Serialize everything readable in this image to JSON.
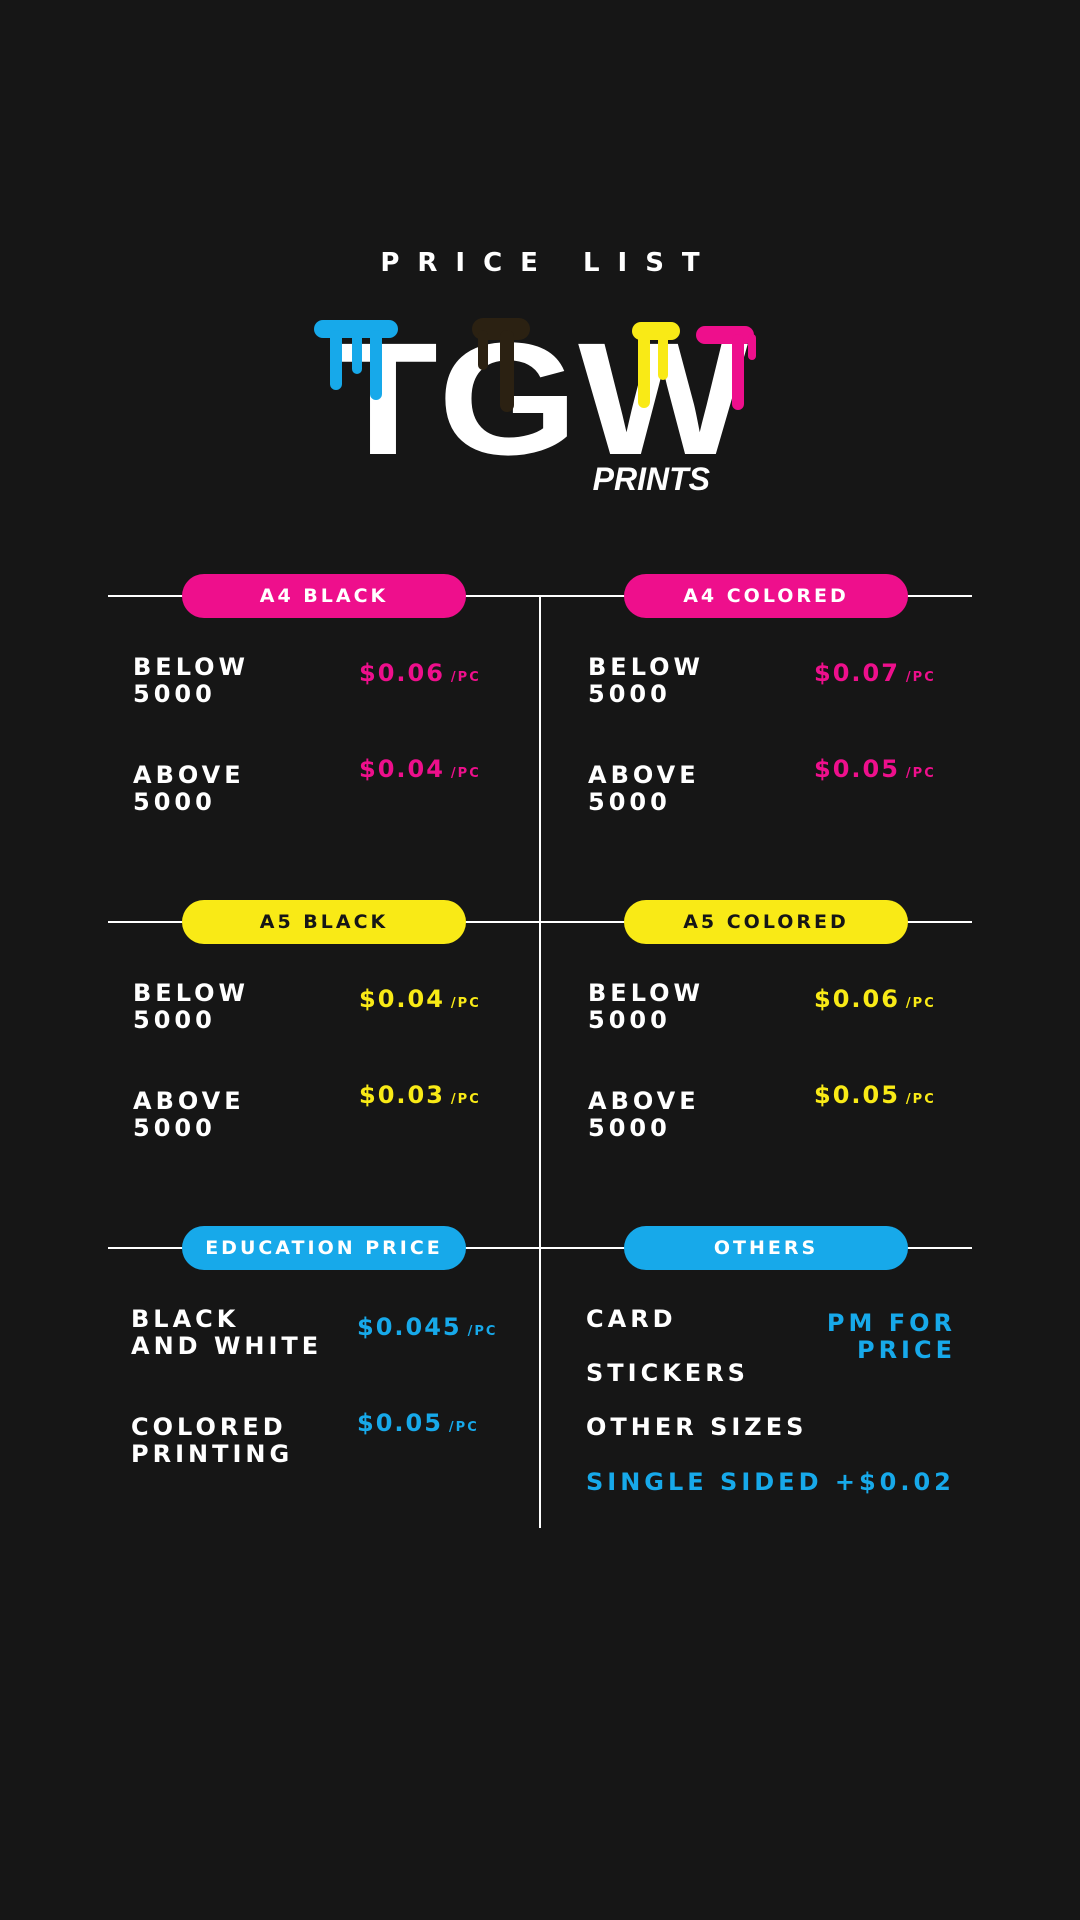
{
  "header": {
    "title": "PRICE LIST"
  },
  "logo": {
    "main": "TGW",
    "sub": "PRINTS",
    "drip_colors": [
      "#17a9ea",
      "#2b2112",
      "#f9ea16",
      "#ee0f8c"
    ]
  },
  "colors": {
    "magenta": "#ee0f8c",
    "yellow": "#f9ea16",
    "blue": "#17a9ea",
    "background": "#161616"
  },
  "a4_black": {
    "title": "A4 BLACK",
    "rows": [
      {
        "label_1": "BELOW",
        "label_2": "5000",
        "price": "$0.06",
        "unit": "/PC"
      },
      {
        "label_1": "ABOVE",
        "label_2": "5000",
        "price": "$0.04",
        "unit": "/PC"
      }
    ]
  },
  "a4_colored": {
    "title": "A4 COLORED",
    "rows": [
      {
        "label_1": "BELOW",
        "label_2": "5000",
        "price": "$0.07",
        "unit": "/PC"
      },
      {
        "label_1": "ABOVE",
        "label_2": "5000",
        "price": "$0.05",
        "unit": "/PC"
      }
    ]
  },
  "a5_black": {
    "title": "A5 BLACK",
    "rows": [
      {
        "label_1": "BELOW",
        "label_2": "5000",
        "price": "$0.04",
        "unit": "/PC"
      },
      {
        "label_1": "ABOVE",
        "label_2": "5000",
        "price": "$0.03",
        "unit": "/PC"
      }
    ]
  },
  "a5_colored": {
    "title": "A5 COLORED",
    "rows": [
      {
        "label_1": "BELOW",
        "label_2": "5000",
        "price": "$0.06",
        "unit": "/PC"
      },
      {
        "label_1": "ABOVE",
        "label_2": "5000",
        "price": "$0.05",
        "unit": "/PC"
      }
    ]
  },
  "education": {
    "title": "EDUCATION PRICE",
    "rows": [
      {
        "label_1": "BLACK",
        "label_2": "AND WHITE",
        "price": "$0.045",
        "unit": "/PC"
      },
      {
        "label_1": "COLORED",
        "label_2": "PRINTING",
        "price": "$0.05",
        "unit": "/PC"
      }
    ]
  },
  "others": {
    "title": "OTHERS",
    "items": [
      "CARD",
      "STICKERS",
      "OTHER SIZES"
    ],
    "pm_line_1": "PM FOR",
    "pm_line_2": "PRICE",
    "single_sided": "SINGLE SIDED +$0.02"
  }
}
